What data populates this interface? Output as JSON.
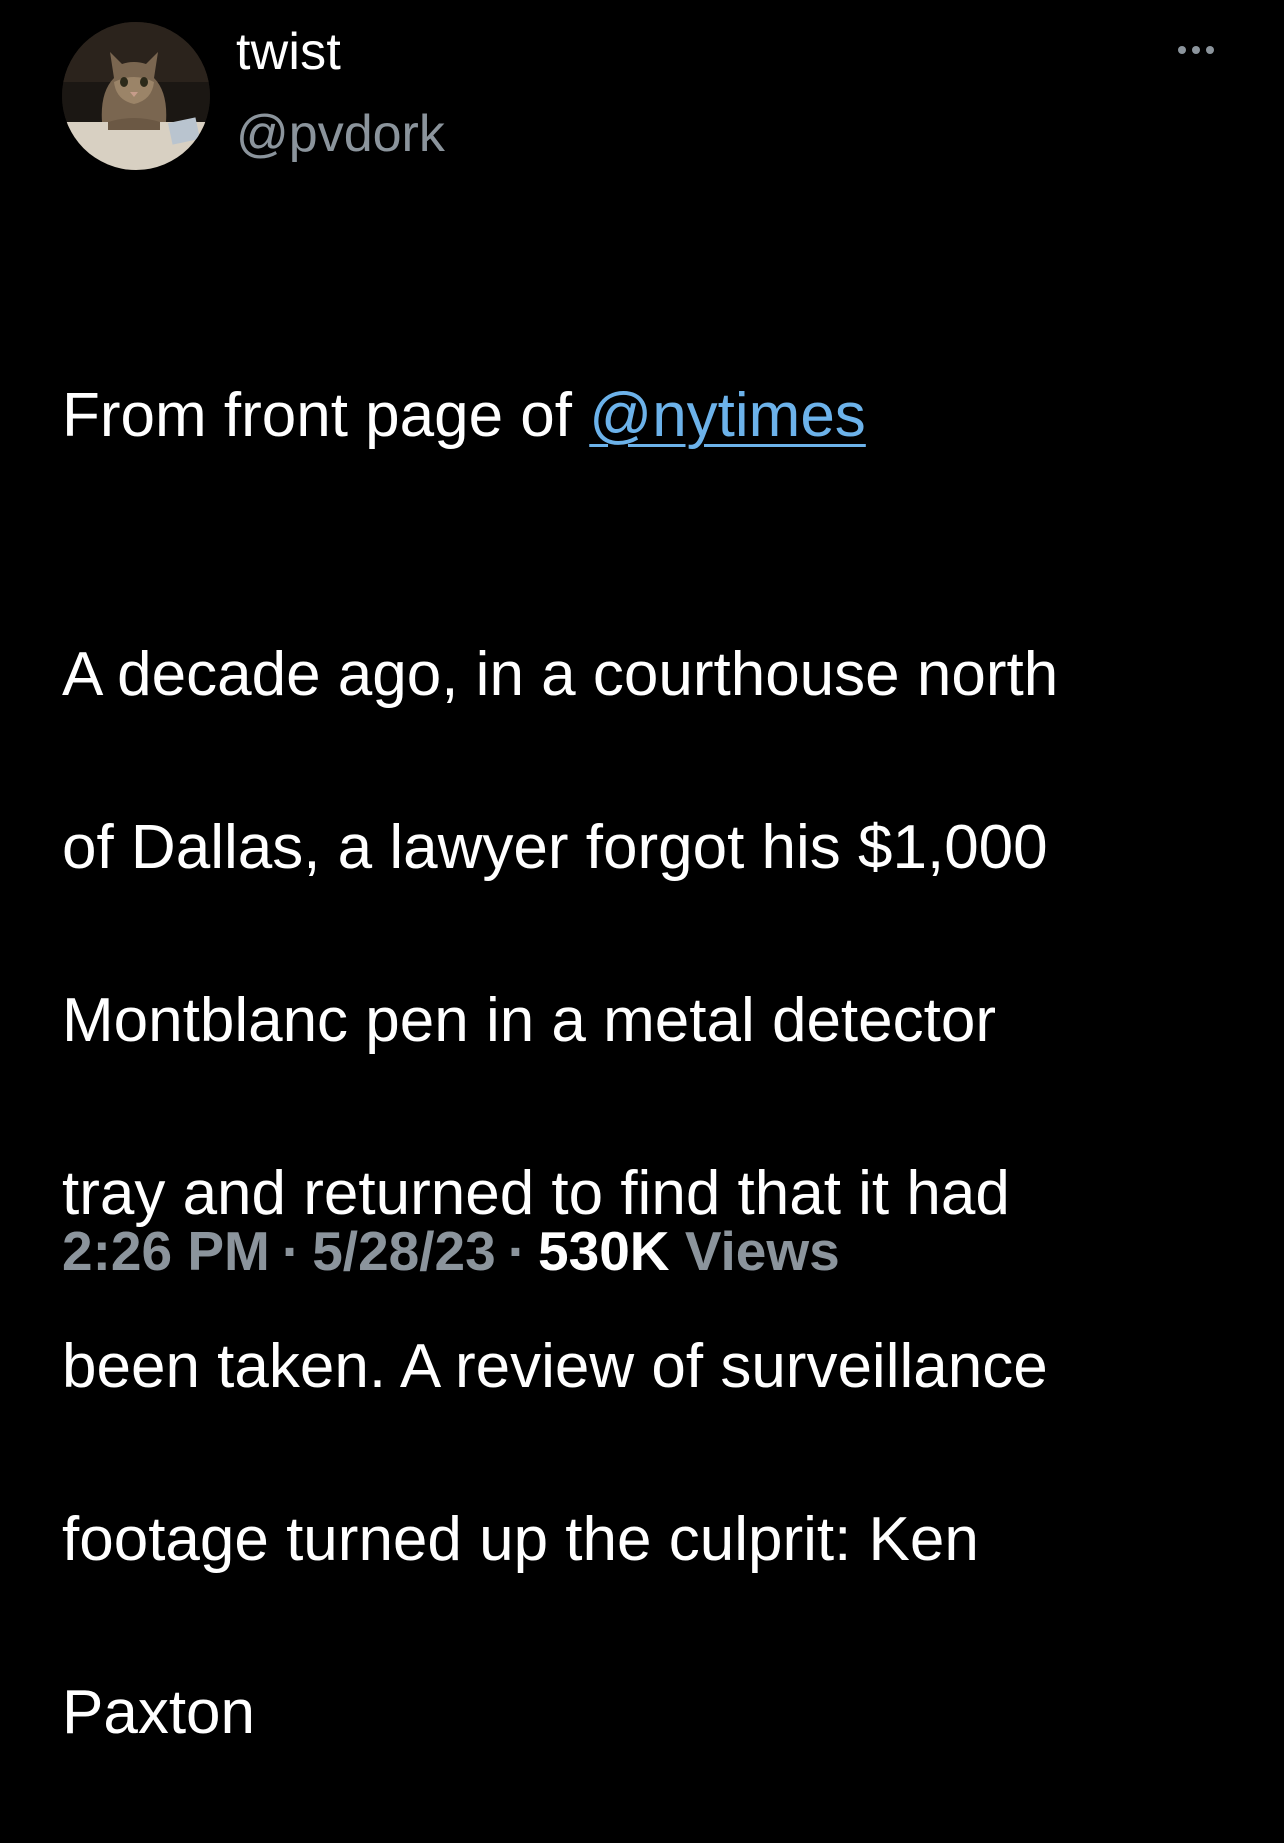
{
  "author": {
    "display_name": "twist",
    "handle": "@pvdork",
    "avatar_icon": "cat-avatar"
  },
  "menu": {
    "icon": "more-dots-icon"
  },
  "tweet": {
    "intro_prefix": "From front page of ",
    "mention": "@nytimes",
    "body_lines": [
      "A decade ago, in a courthouse north",
      "of Dallas, a lawyer forgot his $1,000",
      "Montblanc pen in a metal detector",
      "tray and returned to find that it had",
      "been taken. A review of surveillance",
      "footage turned up the culprit: Ken",
      "Paxton"
    ]
  },
  "meta": {
    "time": "2:26 PM",
    "separator": "·",
    "date": "5/28/23",
    "views_count": "530K",
    "views_label": "Views"
  },
  "colors": {
    "background": "#000000",
    "text": "#ffffff",
    "secondary": "#8b949c",
    "link": "#6cb2ea"
  }
}
